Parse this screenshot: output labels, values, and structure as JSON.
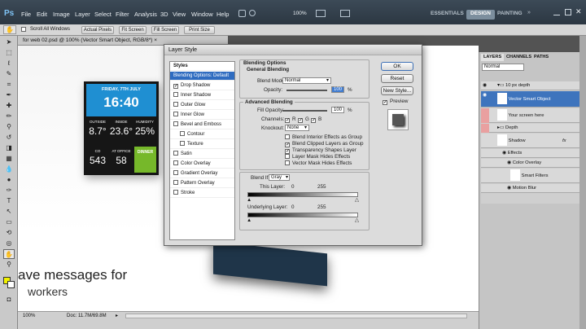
{
  "app": {
    "logo": "Ps",
    "menu": [
      "File",
      "Edit",
      "Image",
      "Layer",
      "Select",
      "Filter",
      "Analysis",
      "3D",
      "View",
      "Window",
      "Help"
    ],
    "zoom": "100%"
  },
  "workspaces": [
    "ESSENTIALS",
    "DESIGN",
    "PAINTING"
  ],
  "options_bar": {
    "scroll_all": "Scroll All Windows",
    "buttons": [
      "Actual Pixels",
      "Fit Screen",
      "Fill Screen",
      "Print Size"
    ]
  },
  "document": {
    "tab_title": "for web 02.psd @ 100% (Vector Smart Object, RGB/8*) ×",
    "zoom_readout": "100%",
    "doc_size": "Doc: 11.7M/69.8M"
  },
  "canvas_text": {
    "line1": "ave messages for",
    "line2": "workers"
  },
  "widget": {
    "date": "FRIDAY, 7TH JULY",
    "time": "16:40",
    "cells": [
      {
        "label": "OUTSIDE",
        "value": "8.7°"
      },
      {
        "label": "INSIDE",
        "value": "23.6°"
      },
      {
        "label": "HUMIDITY",
        "value": "25%"
      },
      {
        "label": "CO",
        "value": "543"
      },
      {
        "label": "AT OFFICE",
        "value": "58"
      },
      {
        "label": "DINNER",
        "value": ""
      }
    ],
    "colors": {
      "header": "#1f8fd2",
      "dinner": "#76b82a"
    }
  },
  "dialog": {
    "title": "Layer Style",
    "styles_header": "Styles",
    "items": [
      {
        "label": "Blending Options: Default",
        "checked": null,
        "selected": true,
        "indent": false
      },
      {
        "label": "Drop Shadow",
        "checked": true,
        "selected": false,
        "indent": false
      },
      {
        "label": "Inner Shadow",
        "checked": false,
        "selected": false,
        "indent": false
      },
      {
        "label": "Outer Glow",
        "checked": false,
        "selected": false,
        "indent": false
      },
      {
        "label": "Inner Glow",
        "checked": false,
        "selected": false,
        "indent": false
      },
      {
        "label": "Bevel and Emboss",
        "checked": false,
        "selected": false,
        "indent": false
      },
      {
        "label": "Contour",
        "checked": false,
        "selected": false,
        "indent": true
      },
      {
        "label": "Texture",
        "checked": false,
        "selected": false,
        "indent": true
      },
      {
        "label": "Satin",
        "checked": false,
        "selected": false,
        "indent": false
      },
      {
        "label": "Color Overlay",
        "checked": false,
        "selected": false,
        "indent": false
      },
      {
        "label": "Gradient Overlay",
        "checked": false,
        "selected": false,
        "indent": false
      },
      {
        "label": "Pattern Overlay",
        "checked": false,
        "selected": false,
        "indent": false
      },
      {
        "label": "Stroke",
        "checked": false,
        "selected": false,
        "indent": false
      }
    ],
    "blending_options": "Blending Options",
    "general_blending": "General Blending",
    "blend_mode_label": "Blend Mode:",
    "blend_mode": "Normal",
    "opacity_label": "Opacity:",
    "opacity": "100",
    "pct": "%",
    "advanced_blending": "Advanced Blending",
    "fill_opacity_label": "Fill Opacity:",
    "fill_opacity": "100",
    "channels_label": "Channels:",
    "channels": [
      "R",
      "G",
      "B"
    ],
    "knockout_label": "Knockout:",
    "knockout": "None",
    "adv_checks": [
      {
        "label": "Blend Interior Effects as Group",
        "checked": false
      },
      {
        "label": "Blend Clipped Layers as Group",
        "checked": true
      },
      {
        "label": "Transparency Shapes Layer",
        "checked": true
      },
      {
        "label": "Layer Mask Hides Effects",
        "checked": false
      },
      {
        "label": "Vector Mask Hides Effects",
        "checked": false
      }
    ],
    "blend_if_label": "Blend If:",
    "blend_if": "Gray",
    "this_layer_label": "This Layer:",
    "this_layer": [
      "0",
      "255"
    ],
    "underlying_label": "Underlying Layer:",
    "underlying": [
      "0",
      "255"
    ],
    "buttons": {
      "ok": "OK",
      "reset": "Reset",
      "new_style": "New Style...",
      "preview": "Preview"
    }
  },
  "layers_panel": {
    "tabs": [
      "LAYERS",
      "CHANNELS",
      "PATHS"
    ],
    "blend": "Normal",
    "rows": [
      {
        "name": "10 px depth",
        "type": "group",
        "selected": false
      },
      {
        "name": "Vector Smart Object",
        "type": "layer",
        "selected": true
      },
      {
        "name": "Your screen here",
        "type": "layer",
        "selected": false
      },
      {
        "name": "Depth",
        "type": "group",
        "selected": false
      },
      {
        "name": "Shadow",
        "type": "layer",
        "selected": false,
        "fx": "fx"
      },
      {
        "name": "Effects",
        "type": "sub",
        "selected": false
      },
      {
        "name": "Color Overlay",
        "type": "sub2",
        "selected": false
      },
      {
        "name": "Smart Filters",
        "type": "sub",
        "selected": false
      },
      {
        "name": "Motion Blur",
        "type": "sub2",
        "selected": false
      }
    ]
  }
}
